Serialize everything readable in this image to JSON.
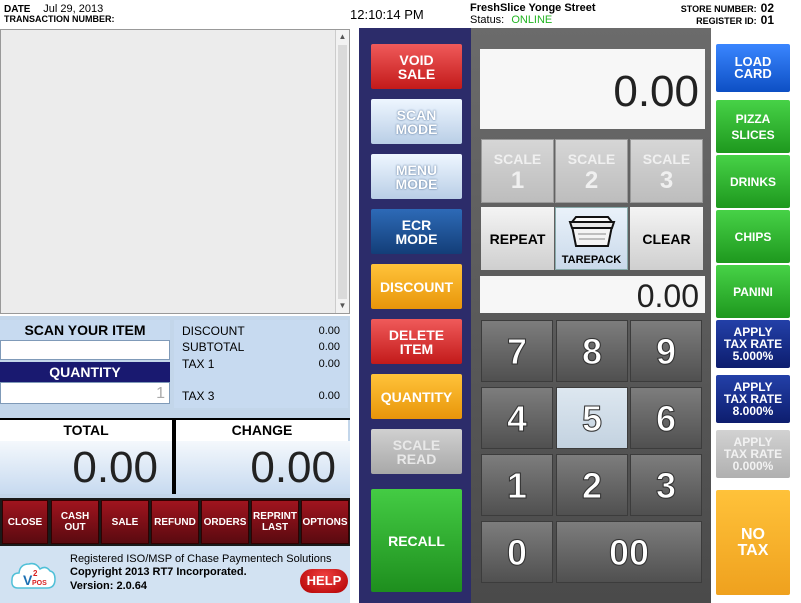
{
  "header": {
    "date_label": "DATE",
    "date_value": "Jul 29, 2013",
    "transaction_label": "TRANSACTION NUMBER:",
    "time": "12:10:14 PM",
    "store_name": "FreshSlice Yonge Street",
    "status_label": "Status:",
    "status_value": "ONLINE",
    "store_number_label": "STORE NUMBER:",
    "store_number": "02",
    "register_id_label": "REGISTER ID:",
    "register_id": "01"
  },
  "scan": {
    "label": "SCAN YOUR ITEM",
    "value": "",
    "quantity_label": "QUANTITY",
    "quantity_value": "1"
  },
  "summary": {
    "discount_label": "DISCOUNT",
    "discount": "0.00",
    "subtotal_label": "SUBTOTAL",
    "subtotal": "0.00",
    "tax1_label": "TAX 1",
    "tax1": "0.00",
    "tax3_label": "TAX 3",
    "tax3": "0.00"
  },
  "totals": {
    "total_label": "TOTAL",
    "total": "0.00",
    "change_label": "CHANGE",
    "change": "0.00"
  },
  "function_buttons": {
    "close": "CLOSE",
    "cash_out_1": "CASH",
    "cash_out_2": "OUT",
    "sale": "SALE",
    "refund": "REFUND",
    "orders": "ORDERS",
    "reprint_1": "REPRINT",
    "reprint_2": "LAST",
    "options": "OPTIONS"
  },
  "footer": {
    "line1": "Registered ISO/MSP of Chase Paymentech Solutions",
    "line2": "Copyright 2013 RT7 Incorporated.",
    "line3": "Version: 2.0.64",
    "help": "HELP",
    "logo_v": "V",
    "logo_sup": "2",
    "logo_pos": "POS"
  },
  "middle": {
    "void_1": "VOID",
    "void_2": "SALE",
    "scan_1": "SCAN",
    "scan_2": "MODE",
    "menu_1": "MENU",
    "menu_2": "MODE",
    "ecr_1": "ECR",
    "ecr_2": "MODE",
    "discount": "DISCOUNT",
    "delete_1": "DELETE",
    "delete_2": "ITEM",
    "quantity": "QUANTITY",
    "scale_read_1": "SCALE",
    "scale_read_2": "READ",
    "recall": "RECALL"
  },
  "keypad": {
    "display_main": "0.00",
    "display_entry": "0.00",
    "scale_label": "SCALE",
    "scale1": "1",
    "scale2": "2",
    "scale3": "3",
    "repeat": "REPEAT",
    "tarepack": "TAREPACK",
    "clear": "CLEAR",
    "k7": "7",
    "k8": "8",
    "k9": "9",
    "k4": "4",
    "k5": "5",
    "k6": "6",
    "k1": "1",
    "k2": "2",
    "k3": "3",
    "k0": "0",
    "k00": "00"
  },
  "right": {
    "load_1": "LOAD",
    "load_2": "CARD",
    "pizza_1": "PIZZA",
    "pizza_2": "SLICES",
    "drinks": "DRINKS",
    "chips": "CHIPS",
    "panini": "PANINI",
    "tax_apply": "APPLY",
    "tax_rate": "TAX RATE",
    "tax_a": "5.000%",
    "tax_b": "8.000%",
    "tax_c": "0.000%",
    "no_1": "NO",
    "no_2": "TAX"
  }
}
